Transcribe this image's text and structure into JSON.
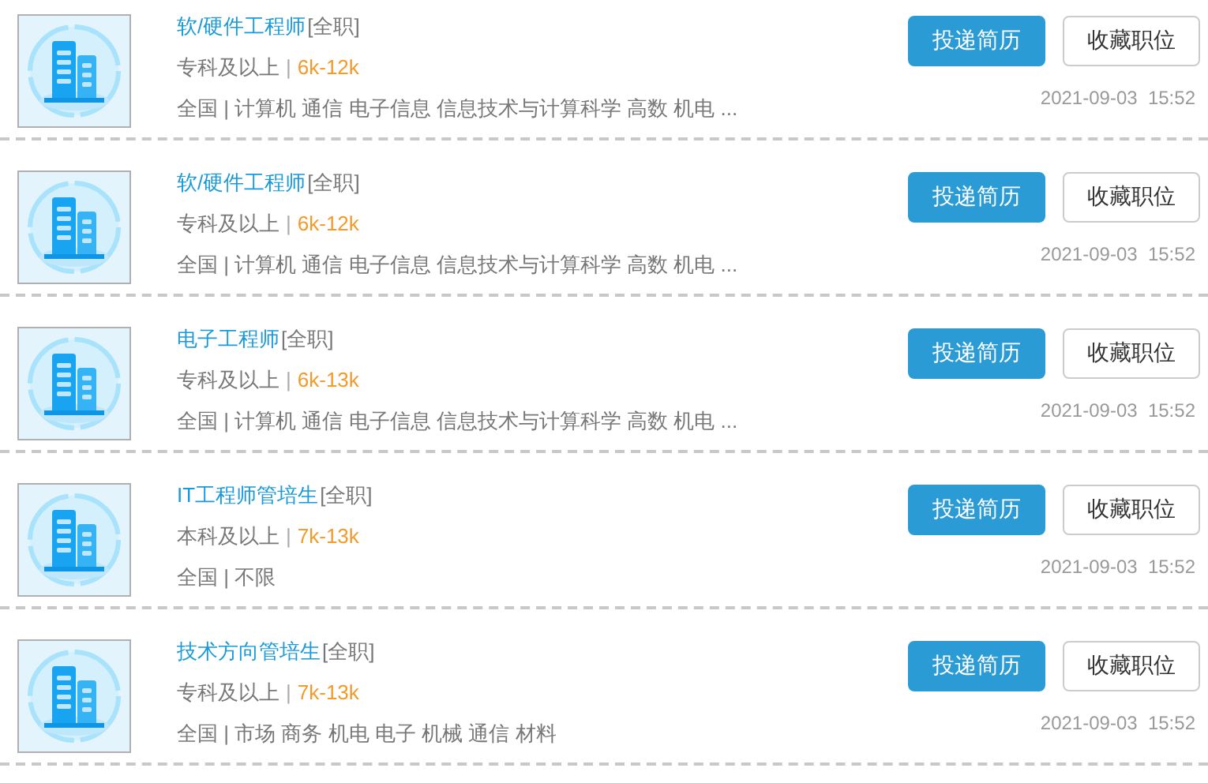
{
  "jobs": [
    {
      "title": "软/硬件工程师",
      "type": "[全职]",
      "education": "专科及以上",
      "separator": "|",
      "salary": "6k-12k",
      "details": "全国 | 计算机 通信 电子信息 信息技术与计算科学 高数 机电 ...",
      "apply": "投递简历",
      "save": "收藏职位",
      "date": "2021-09-03  15:52"
    },
    {
      "title": "软/硬件工程师",
      "type": "[全职]",
      "education": "专科及以上",
      "separator": "|",
      "salary": "6k-12k",
      "details": "全国 | 计算机 通信 电子信息 信息技术与计算科学 高数 机电 ...",
      "apply": "投递简历",
      "save": "收藏职位",
      "date": "2021-09-03  15:52"
    },
    {
      "title": "电子工程师",
      "type": "[全职]",
      "education": "专科及以上",
      "separator": "|",
      "salary": "6k-13k",
      "details": "全国 | 计算机 通信 电子信息 信息技术与计算科学 高数 机电 ...",
      "apply": "投递简历",
      "save": "收藏职位",
      "date": "2021-09-03  15:52"
    },
    {
      "title": "IT工程师管培生",
      "type": "[全职]",
      "education": "本科及以上",
      "separator": "|",
      "salary": "7k-13k",
      "details": "全国 | 不限",
      "apply": "投递简历",
      "save": "收藏职位",
      "date": "2021-09-03  15:52"
    },
    {
      "title": "技术方向管培生",
      "type": "[全职]",
      "education": "专科及以上",
      "separator": "|",
      "salary": "7k-13k",
      "details": "全国 | 市场 商务 机电 电子 机械 通信 材料",
      "apply": "投递简历",
      "save": "收藏职位",
      "date": "2021-09-03  15:52"
    }
  ]
}
